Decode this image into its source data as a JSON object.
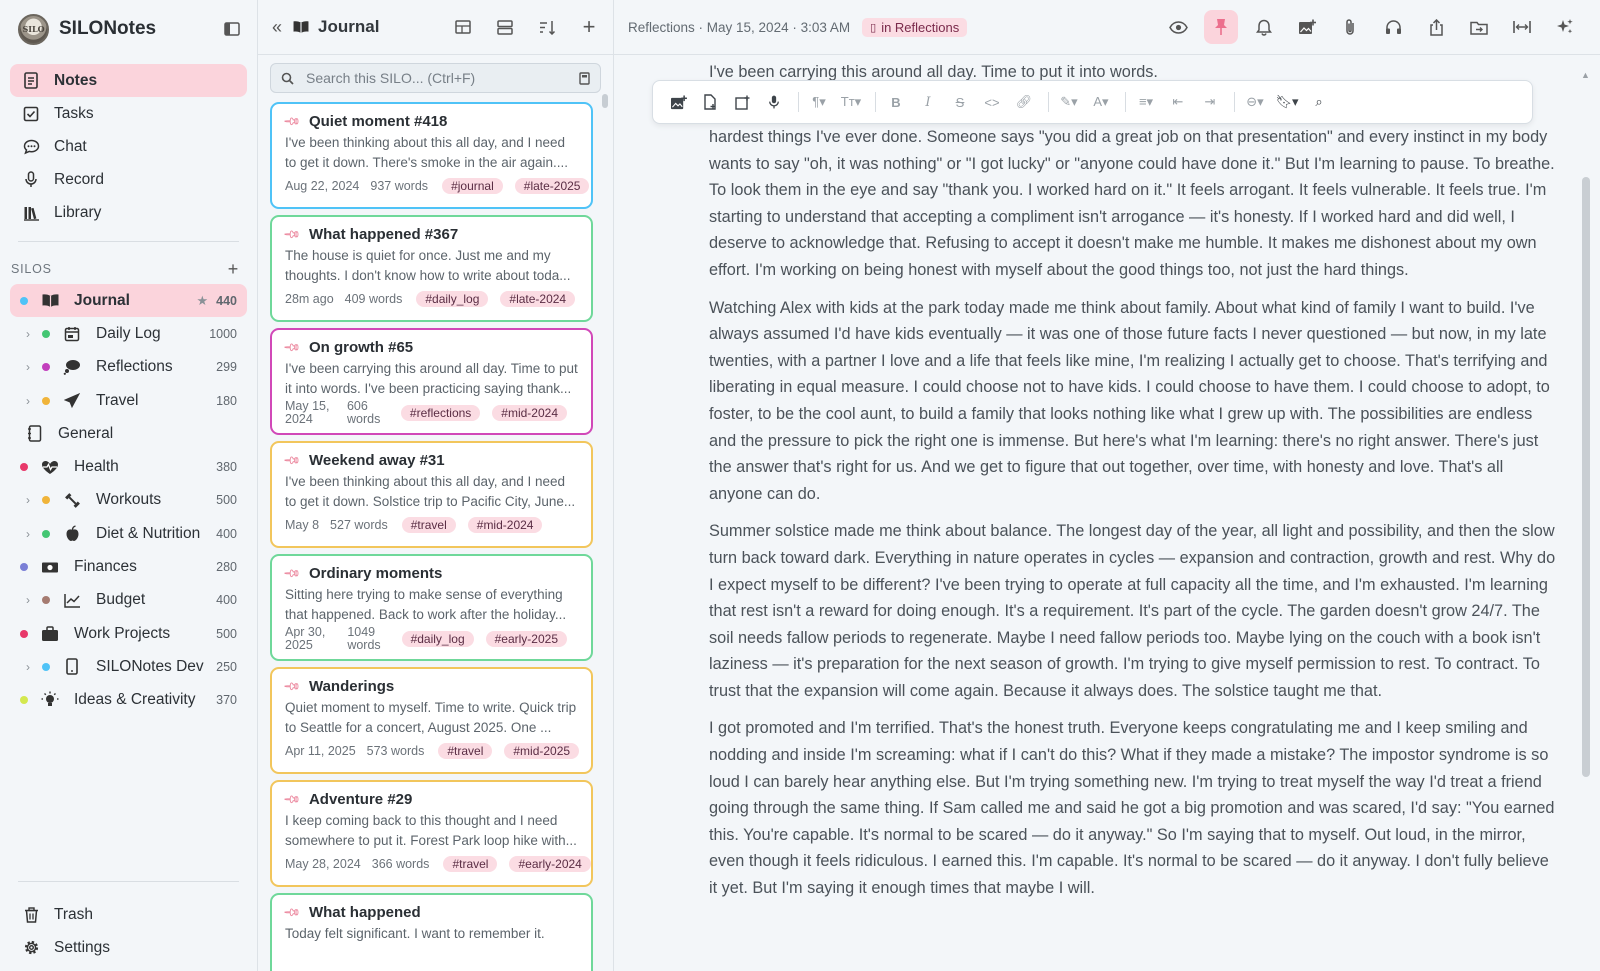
{
  "app": {
    "name": "SILONotes"
  },
  "sidebar": {
    "nav": [
      {
        "label": "Notes",
        "icon": "notes-icon",
        "active": true
      },
      {
        "label": "Tasks",
        "icon": "tasks-icon"
      },
      {
        "label": "Chat",
        "icon": "chat-icon"
      },
      {
        "label": "Record",
        "icon": "microphone-icon"
      },
      {
        "label": "Library",
        "icon": "library-icon"
      }
    ],
    "silos_heading": "SILOS",
    "silos": [
      {
        "label": "Journal",
        "count": "440",
        "dot": "#4fc3f7",
        "icon": "book-icon",
        "active": true,
        "starred": true
      },
      {
        "label": "Daily Log",
        "count": "1000",
        "dot": "#43c673",
        "icon": "calendar-icon",
        "child": true
      },
      {
        "label": "Reflections",
        "count": "299",
        "dot": "#c23fbd",
        "icon": "thought-bubble-icon",
        "child": true
      },
      {
        "label": "Travel",
        "count": "180",
        "dot": "#f0b43a",
        "icon": "airplane-icon",
        "child": true
      },
      {
        "label": "General",
        "count": "",
        "dot": "",
        "icon": "notebook-icon"
      },
      {
        "label": "Health",
        "count": "380",
        "dot": "#e8386a",
        "icon": "heart-pulse-icon"
      },
      {
        "label": "Workouts",
        "count": "500",
        "dot": "#f0b43a",
        "icon": "dumbbell-icon",
        "child": true
      },
      {
        "label": "Diet & Nutrition",
        "count": "400",
        "dot": "#43c673",
        "icon": "apple-icon",
        "child": true
      },
      {
        "label": "Finances",
        "count": "280",
        "dot": "#7a7fd6",
        "icon": "cash-icon"
      },
      {
        "label": "Budget",
        "count": "400",
        "dot": "#a57b71",
        "icon": "line-chart-icon",
        "child": true
      },
      {
        "label": "Work Projects",
        "count": "500",
        "dot": "#e8386a",
        "icon": "briefcase-icon"
      },
      {
        "label": "SILONotes Dev",
        "count": "250",
        "dot": "#4fc3f7",
        "icon": "phone-icon",
        "child": true
      },
      {
        "label": "Ideas & Creativity",
        "count": "370",
        "dot": "#d4e84f",
        "icon": "lightbulb-icon"
      }
    ],
    "bottom": [
      {
        "label": "Trash",
        "icon": "trash-icon"
      },
      {
        "label": "Settings",
        "icon": "settings-icon"
      }
    ]
  },
  "list": {
    "title": "Journal",
    "search_placeholder": "Search this SILO...  (Ctrl+F)",
    "cards": [
      {
        "title": "Quiet moment #418",
        "excerpt": "I've been thinking about this all day, and I need to get it down. There's smoke in the air again....",
        "date": "Aug 22, 2024",
        "words": "937 words",
        "tags": [
          "#journal",
          "#late-2025"
        ],
        "border": "#4fc3f7",
        "tagbg": [
          "#fbdce3",
          "#fbdce3"
        ]
      },
      {
        "title": "What happened #367",
        "excerpt": "The house is quiet for once. Just me and my thoughts. I don't know how to write about toda...",
        "date": "28m ago",
        "words": "409 words",
        "tags": [
          "#daily_log",
          "#late-2024"
        ],
        "border": "#6fd89a",
        "tagbg": [
          "#fbdce3",
          "#fbdce3"
        ]
      },
      {
        "title": "On growth #65",
        "excerpt": "I've been carrying this around all day. Time to put it into words. I've been practicing saying thank...",
        "date": "May 15, 2024",
        "words": "606 words",
        "tags": [
          "#reflections",
          "#mid-2024"
        ],
        "border": "#d148b8",
        "stack": true,
        "tagbg": [
          "#fbdce3",
          "#fbdce3"
        ]
      },
      {
        "title": "Weekend away #31",
        "excerpt": "I've been thinking about this all day, and I need to get it down. Solstice trip to Pacific City, June...",
        "date": "May 8",
        "words": "527 words",
        "tags": [
          "#travel",
          "#mid-2024"
        ],
        "border": "#f2c65c",
        "tagbg": [
          "#fbdce3",
          "#fbdce3"
        ]
      },
      {
        "title": "Ordinary moments",
        "excerpt": "Sitting here trying to make sense of everything that happened. Back to work after the holiday...",
        "date": "Apr 30, 2025",
        "words": "1049 words",
        "tags": [
          "#daily_log",
          "#early-2025"
        ],
        "border": "#6fd89a",
        "stack": true,
        "tagbg": [
          "#fbdce3",
          "#fbdce3"
        ]
      },
      {
        "title": "Wanderings",
        "excerpt": "Quiet moment to myself. Time to write. Quick trip to Seattle for a concert, August 2025. One ...",
        "date": "Apr 11, 2025",
        "words": "573 words",
        "tags": [
          "#travel",
          "#mid-2025"
        ],
        "border": "#f2c65c",
        "tagbg": [
          "#fbdce3",
          "#fbdce3"
        ]
      },
      {
        "title": "Adventure #29",
        "excerpt": "I keep coming back to this thought and I need somewhere to put it. Forest Park loop hike with...",
        "date": "May 28, 2024",
        "words": "366 words",
        "tags": [
          "#travel",
          "#early-2024"
        ],
        "border": "#f2c65c",
        "tagbg": [
          "#fbdce3",
          "#fbdce3"
        ]
      },
      {
        "title": "What happened",
        "excerpt": "Today felt significant. I want to remember it.",
        "date": "",
        "words": "",
        "tags": [],
        "border": "#6fd89a",
        "tagbg": []
      }
    ]
  },
  "editor": {
    "breadcrumb": "Reflections · May 15, 2024 · 3:03 AM",
    "chip": "in Reflections",
    "first_line": "I've been carrying this around all day. Time to put it into words.",
    "paragraphs": [
      "hardest things I've ever done. Someone says \"you did a great job on that presentation\" and every instinct in my body wants to say \"oh, it was nothing\" or \"I got lucky\" or \"anyone could have done it.\" But I'm learning to pause. To breathe. To look them in the eye and say \"thank you. I worked hard on it.\" It feels arrogant. It feels vulnerable. It feels true. I'm starting to understand that accepting a compliment isn't arrogance — it's honesty. If I worked hard and did well, I deserve to acknowledge that. Refusing to accept it doesn't make me humble. It makes me dishonest about my own effort. I'm working on being honest with myself about the good things too, not just the hard things.",
      "Watching Alex with kids at the park today made me think about family. About what kind of family I want to build. I've always assumed I'd have kids eventually — it was one of those future facts I never questioned — but now, in my late twenties, with a partner I love and a life that feels like mine, I'm realizing I actually get to choose. That's terrifying and liberating in equal measure. I could choose not to have kids. I could choose to have them. I could choose to adopt, to foster, to be the cool aunt, to build a family that looks nothing like what I grew up with. The possibilities are endless and the pressure to pick the right one is immense. But here's what I'm learning: there's no right answer. There's just the answer that's right for us. And we get to figure that out together, over time, with honesty and love. That's all anyone can do.",
      "Summer solstice made me think about balance. The longest day of the year, all light and possibility, and then the slow turn back toward dark. Everything in nature operates in cycles — expansion and contraction, growth and rest. Why do I expect myself to be different? I've been trying to operate at full capacity all the time, and I'm exhausted. I'm learning that rest isn't a reward for doing enough. It's a requirement. It's part of the cycle. The garden doesn't grow 24/7. The soil needs fallow periods to regenerate. Maybe I need fallow periods too. Maybe lying on the couch with a book isn't laziness — it's preparation for the next season of growth. I'm trying to give myself permission to rest. To contract. To trust that the expansion will come again. Because it always does. The solstice taught me that.",
      "I got promoted and I'm terrified. That's the honest truth. Everyone keeps congratulating me and I keep smiling and nodding and inside I'm screaming: what if I can't do this? What if they made a mistake? The impostor syndrome is so loud I can barely hear anything else. But I'm trying something new. I'm trying to treat myself the way I'd treat a friend going through the same thing. If Sam called me and said he got a big promotion and was scared, I'd say: \"You earned this. You're capable. It's normal to be scared — do it anyway.\" So I'm saying that to myself. Out loud, in the mirror, even though it feels ridiculous. I earned this. I'm capable. It's normal to be scared — do it anyway. I don't fully believe it yet. But I'm saying it enough times that maybe I will."
    ]
  },
  "colors": {
    "accent_pink": "#fbd4dc",
    "pin_pink": "#ec8aa0"
  }
}
